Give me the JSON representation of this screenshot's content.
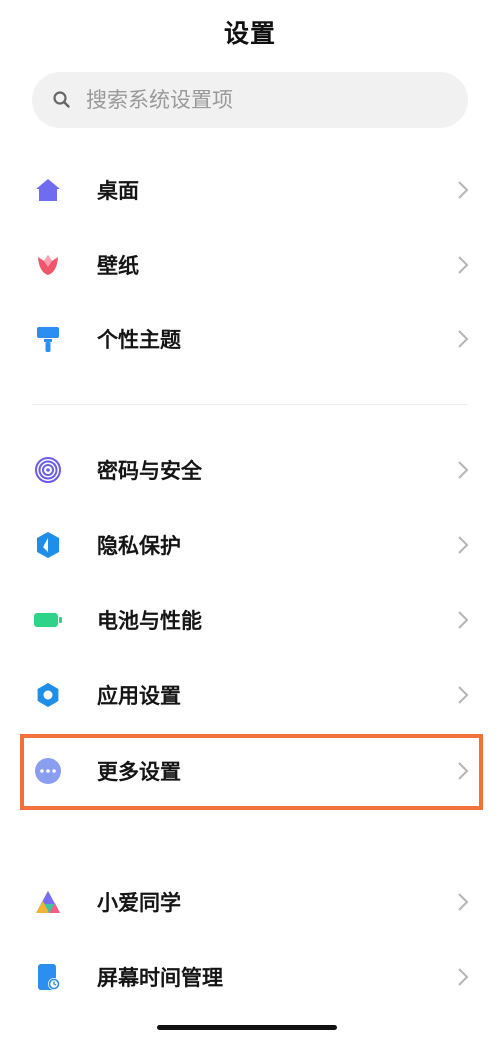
{
  "header": {
    "title": "设置"
  },
  "search": {
    "placeholder": "搜索系统设置项",
    "icon": "search-icon"
  },
  "groups": [
    [
      {
        "label": "桌面",
        "icon": "home-icon",
        "color": "#6f6cf2"
      },
      {
        "label": "壁纸",
        "icon": "tulip-icon",
        "color": "#f2566d"
      },
      {
        "label": "个性主题",
        "icon": "paint-brush-icon",
        "color": "#2b8ef0"
      }
    ],
    [
      {
        "label": "密码与安全",
        "icon": "fingerprint-icon",
        "color": "#6a5ce8"
      },
      {
        "label": "隐私保护",
        "icon": "shield-icon",
        "color": "#1f8ee8"
      },
      {
        "label": "电池与性能",
        "icon": "battery-icon",
        "color": "#2ed38a"
      },
      {
        "label": "应用设置",
        "icon": "gear-icon",
        "color": "#1f8ee8"
      },
      {
        "label": "更多设置",
        "icon": "more-dots-icon",
        "color": "#8a9ef0",
        "highlighted": true
      }
    ],
    [
      {
        "label": "小爱同学",
        "icon": "xiaoai-icon",
        "color": "#3ec4a0"
      },
      {
        "label": "屏幕时间管理",
        "icon": "screen-time-icon",
        "color": "#2b8ef0"
      }
    ]
  ],
  "highlight_color": "#f36f3b"
}
